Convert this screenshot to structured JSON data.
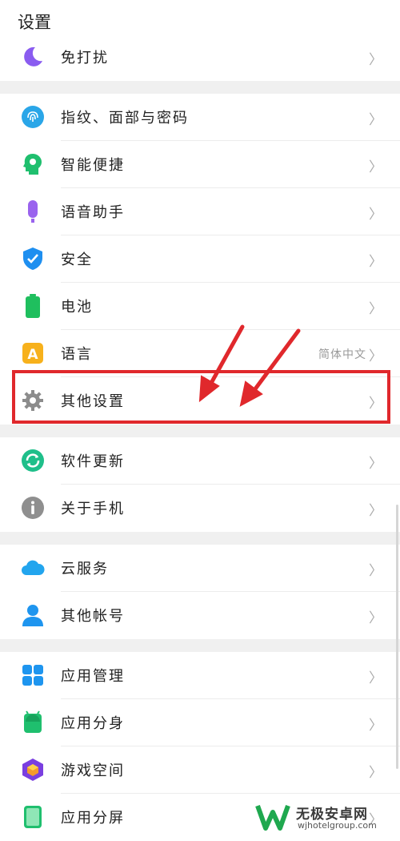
{
  "header": {
    "title": "设置"
  },
  "groups": [
    {
      "items": [
        {
          "label": "免打扰",
          "icon": "moon-icon"
        }
      ]
    },
    {
      "items": [
        {
          "label": "指纹、面部与密码",
          "icon": "fingerprint-icon"
        },
        {
          "label": "智能便捷",
          "icon": "smart-head-icon"
        },
        {
          "label": "语音助手",
          "icon": "microphone-icon"
        },
        {
          "label": "安全",
          "icon": "shield-icon"
        },
        {
          "label": "电池",
          "icon": "battery-icon"
        },
        {
          "label": "语言",
          "value": "简体中文",
          "icon": "language-icon"
        },
        {
          "label": "其他设置",
          "icon": "gear-icon"
        }
      ]
    },
    {
      "items": [
        {
          "label": "软件更新",
          "icon": "update-icon"
        },
        {
          "label": "关于手机",
          "icon": "info-icon"
        }
      ]
    },
    {
      "items": [
        {
          "label": "云服务",
          "icon": "cloud-icon"
        },
        {
          "label": "其他帐号",
          "icon": "person-icon"
        }
      ]
    },
    {
      "items": [
        {
          "label": "应用管理",
          "icon": "apps-grid-icon"
        },
        {
          "label": "应用分身",
          "icon": "android-icon"
        },
        {
          "label": "游戏空间",
          "icon": "game-cube-icon"
        },
        {
          "label": "应用分屏",
          "icon": "split-screen-icon"
        }
      ]
    }
  ],
  "chevron": "〉",
  "watermark": {
    "name": "无极安卓网",
    "url": "wjhotelgroup.com"
  },
  "colors": {
    "highlight": "#e0282c",
    "arrow": "#e0282c"
  }
}
